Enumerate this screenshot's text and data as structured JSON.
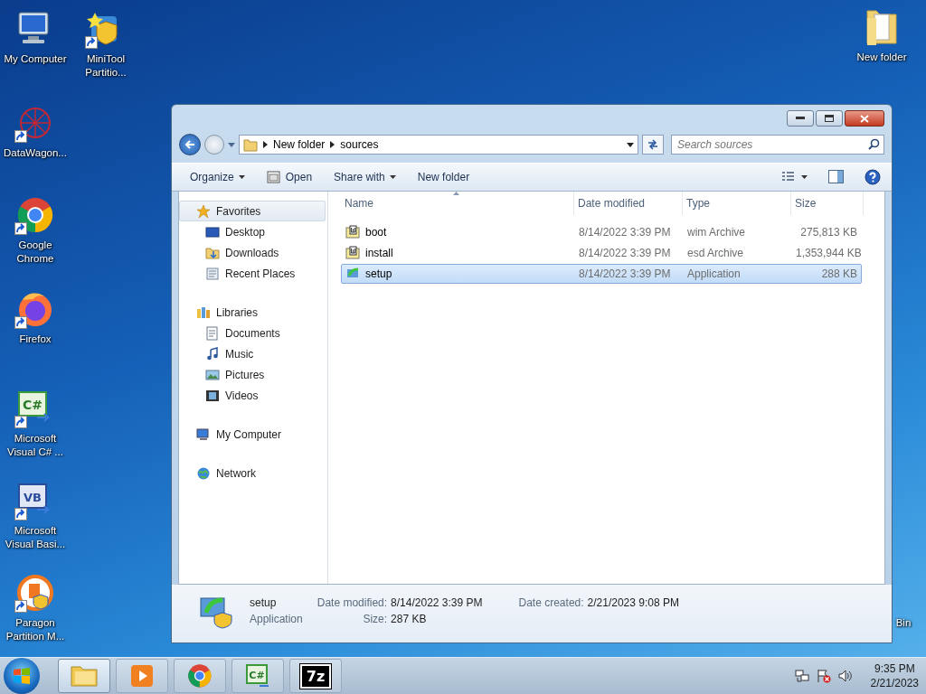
{
  "desktop_icons": [
    {
      "label": "My Computer",
      "kind": "computer",
      "shortcut": false
    },
    {
      "label": "MiniTool Partitio...",
      "kind": "minitool",
      "shortcut": true
    },
    {
      "label": "DataWagon...",
      "kind": "datawagon",
      "shortcut": true
    },
    {
      "label": "Google Chrome",
      "kind": "chrome",
      "shortcut": true
    },
    {
      "label": "Firefox",
      "kind": "firefox",
      "shortcut": true
    },
    {
      "label": "Microsoft Visual C# ...",
      "kind": "csharp",
      "shortcut": true,
      "logo_text": "C#"
    },
    {
      "label": "Microsoft Visual Basi...",
      "kind": "vb",
      "shortcut": true,
      "logo_text": "VB"
    },
    {
      "label": "Paragon Partition M...",
      "kind": "paragon",
      "shortcut": true
    },
    {
      "label": "New folder",
      "kind": "folder",
      "shortcut": false
    },
    {
      "label": "Bin",
      "kind": "bin"
    }
  ],
  "window": {
    "breadcrumb": [
      "New folder",
      "sources"
    ],
    "search": {
      "placeholder": "Search sources"
    },
    "toolbar": [
      {
        "label": "Organize",
        "kind": "menu"
      },
      {
        "label": "Open",
        "kind": "open"
      },
      {
        "label": "Share with",
        "kind": "menu"
      },
      {
        "label": "New folder",
        "kind": "plain"
      }
    ],
    "nav": [
      {
        "label": "Favorites",
        "kind": "star",
        "selected": true,
        "children": [
          {
            "label": "Desktop",
            "kind": "desktop",
            "selected": false
          },
          {
            "label": "Downloads",
            "kind": "downloads",
            "selected": false
          },
          {
            "label": "Recent Places",
            "kind": "recent",
            "selected": false
          }
        ]
      },
      {
        "label": "Libraries",
        "kind": "library",
        "selected": false,
        "children": [
          {
            "label": "Documents",
            "kind": "documents",
            "selected": false
          },
          {
            "label": "Music",
            "kind": "music",
            "selected": false
          },
          {
            "label": "Pictures",
            "kind": "pictures",
            "selected": false
          },
          {
            "label": "Videos",
            "kind": "videos",
            "selected": false
          }
        ]
      },
      {
        "label": "My Computer",
        "kind": "computer",
        "selected": false
      },
      {
        "label": "Network",
        "kind": "network",
        "selected": false
      }
    ],
    "columns": [
      "Name",
      "Date modified",
      "Type",
      "Size"
    ],
    "rows": [
      {
        "name": "boot",
        "kind": "archive",
        "date": "8/14/2022 3:39 PM",
        "type": "wim Archive",
        "size": "275,813 KB",
        "selected": false
      },
      {
        "name": "install",
        "kind": "archive",
        "date": "8/14/2022 3:39 PM",
        "type": "esd Archive",
        "size": "1,353,944 KB",
        "selected": false
      },
      {
        "name": "setup",
        "kind": "setup",
        "date": "8/14/2022 3:39 PM",
        "type": "Application",
        "size": "288 KB",
        "selected": true
      }
    ],
    "details": {
      "name": "setup",
      "type": "Application",
      "fields": [
        {
          "label": "Date modified:",
          "value": "8/14/2022 3:39 PM"
        },
        {
          "label": "Date created:",
          "value": "2/21/2023 9:08 PM"
        },
        {
          "label": "Size:",
          "value": "287 KB"
        }
      ]
    }
  },
  "taskbar": {
    "items": [
      {
        "kind": "explorer",
        "active": true
      },
      {
        "kind": "media",
        "active": false
      },
      {
        "kind": "chrome",
        "active": false
      },
      {
        "kind": "csharp",
        "active": false,
        "logo_text": "C#"
      },
      {
        "kind": "sevenzip",
        "active": false,
        "label": "7z"
      }
    ],
    "time": "9:35 PM",
    "date": "2/21/2023"
  }
}
